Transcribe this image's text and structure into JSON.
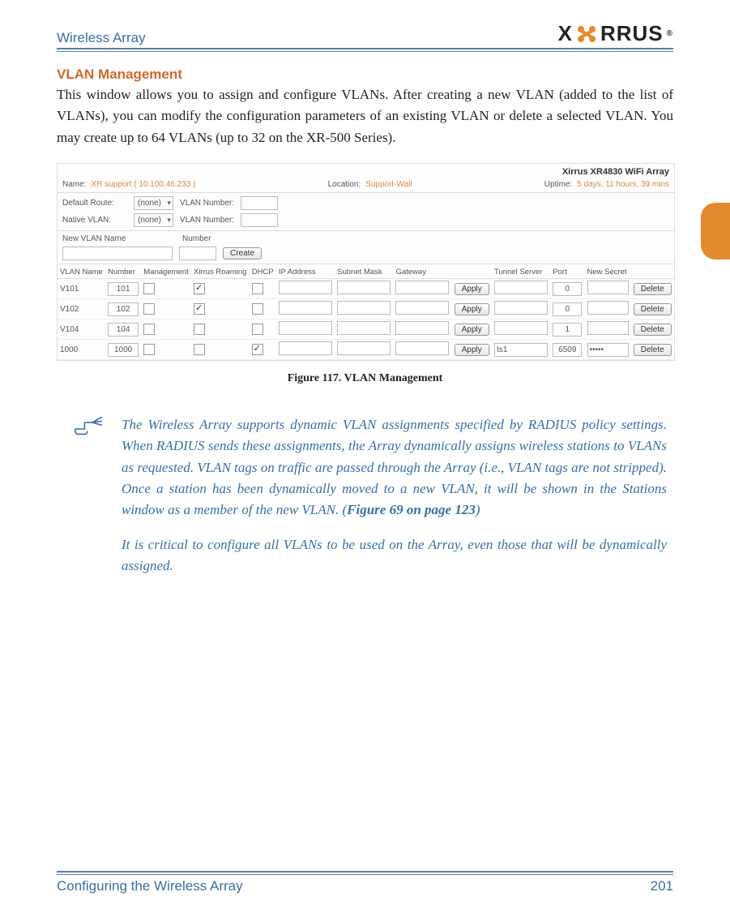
{
  "header": {
    "left": "Wireless Array",
    "logo_text_pre": "X",
    "logo_text_post": "RRUS"
  },
  "section": {
    "title": "VLAN Management",
    "paragraph": "This window allows you to assign and configure VLANs. After creating a new VLAN (added to the list of VLANs), you can modify the configuration parameters of an existing VLAN or delete a selected VLAN. You may create up to 64 VLANs (up to 32 on the XR-500 Series)."
  },
  "figure": {
    "device_title": "Xirrus XR4830 WiFi Array",
    "info": {
      "name_label": "Name:",
      "name_value": "XR support   ( 10.100.46.233 )",
      "location_label": "Location:",
      "location_value": "Support-Wall",
      "uptime_label": "Uptime:",
      "uptime_value": "5 days, 11 hours, 39 mins"
    },
    "defaults": {
      "default_route_label": "Default Route:",
      "native_vlan_label": "Native VLAN:",
      "select_value": "(none)",
      "vlan_number_label": "VLAN Number:"
    },
    "new_vlan": {
      "name_label": "New VLAN Name",
      "number_label": "Number",
      "create_btn": "Create"
    },
    "table": {
      "headers": [
        "VLAN Name",
        "Number",
        "Management",
        "Xirrus Roaming",
        "DHCP",
        "IP Address",
        "Subnet Mask",
        "Gateway",
        "",
        "Tunnel Server",
        "Port",
        "New Secret",
        ""
      ],
      "rows": [
        {
          "name": "V101",
          "num": "101",
          "mgmt": false,
          "roam": true,
          "dhcp": false,
          "ip": "",
          "mask": "",
          "gw": "",
          "apply": "Apply",
          "tunnel": "",
          "port": "0",
          "secret": "",
          "delete": "Delete"
        },
        {
          "name": "V102",
          "num": "102",
          "mgmt": false,
          "roam": true,
          "dhcp": false,
          "ip": "",
          "mask": "",
          "gw": "",
          "apply": "Apply",
          "tunnel": "",
          "port": "0",
          "secret": "",
          "delete": "Delete"
        },
        {
          "name": "V104",
          "num": "104",
          "mgmt": false,
          "roam": false,
          "dhcp": false,
          "ip": "",
          "mask": "",
          "gw": "",
          "apply": "Apply",
          "tunnel": "",
          "port": "1",
          "secret": "",
          "delete": "Delete"
        },
        {
          "name": "1000",
          "num": "1000",
          "mgmt": false,
          "roam": false,
          "dhcp": true,
          "ip": "",
          "mask": "",
          "gw": "",
          "apply": "Apply",
          "tunnel": "ts1",
          "port": "6509",
          "secret": "•••••",
          "delete": "Delete"
        }
      ]
    },
    "caption": "Figure 117. VLAN Management"
  },
  "note": {
    "p1_a": "The Wireless Array supports dynamic VLAN assignments specified by RADIUS policy settings. When RADIUS sends these assignments, the Array dynamically assigns wireless stations to VLANs as requested. VLAN tags on traffic are passed through the Array (i.e., VLAN tags are not stripped). Once a station has been dynamically moved to a new VLAN, it will be shown in the Stations window as a member of the new VLAN. (",
    "fig_ref": "Figure 69 on page 123",
    "p1_b": ")",
    "p2": "It is critical to configure all VLANs to be used on the Array, even those that will be dynamically assigned."
  },
  "footer": {
    "left": "Configuring the Wireless Array",
    "right": "201"
  }
}
